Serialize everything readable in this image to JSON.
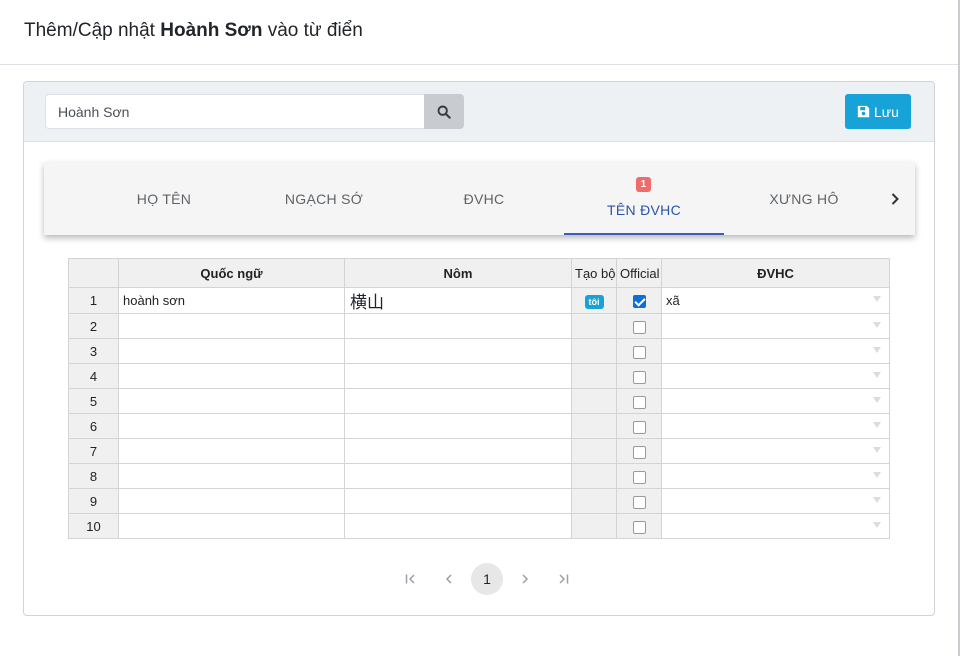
{
  "modal": {
    "title_prefix": "Thêm/Cập nhật ",
    "title_name": "Hoành Sơn",
    "title_suffix": " vào từ điển"
  },
  "toolbar": {
    "search_value": "Hoành Sơn",
    "search_icon": "search-icon",
    "save_label": "Lưu",
    "save_icon": "floppy-disk-icon",
    "save_color": "#17a2d8"
  },
  "tabs": [
    {
      "label": "HỌ TÊN",
      "active": false
    },
    {
      "label": "NGẠCH SỚ",
      "active": false
    },
    {
      "label": "ĐVHC",
      "active": false
    },
    {
      "label": "TÊN ĐVHC",
      "active": true,
      "badge": "1"
    },
    {
      "label": "XƯNG HÔ",
      "active": false
    }
  ],
  "tabs_accent": "#3f5bc0",
  "table": {
    "headers": [
      "",
      "Quốc ngữ",
      "Nôm",
      "Tạo bộ",
      "Official",
      "ĐVHC"
    ],
    "rows": [
      {
        "num": "1",
        "quoc_ngu": "hoành sơn",
        "nom": "横山",
        "tag": "tôi",
        "official": true,
        "dvhc": "xã"
      },
      {
        "num": "2",
        "quoc_ngu": "",
        "nom": "",
        "tag": "",
        "official": false,
        "dvhc": ""
      },
      {
        "num": "3",
        "quoc_ngu": "",
        "nom": "",
        "tag": "",
        "official": false,
        "dvhc": ""
      },
      {
        "num": "4",
        "quoc_ngu": "",
        "nom": "",
        "tag": "",
        "official": false,
        "dvhc": ""
      },
      {
        "num": "5",
        "quoc_ngu": "",
        "nom": "",
        "tag": "",
        "official": false,
        "dvhc": ""
      },
      {
        "num": "6",
        "quoc_ngu": "",
        "nom": "",
        "tag": "",
        "official": false,
        "dvhc": ""
      },
      {
        "num": "7",
        "quoc_ngu": "",
        "nom": "",
        "tag": "",
        "official": false,
        "dvhc": ""
      },
      {
        "num": "8",
        "quoc_ngu": "",
        "nom": "",
        "tag": "",
        "official": false,
        "dvhc": ""
      },
      {
        "num": "9",
        "quoc_ngu": "",
        "nom": "",
        "tag": "",
        "official": false,
        "dvhc": ""
      },
      {
        "num": "10",
        "quoc_ngu": "",
        "nom": "",
        "tag": "",
        "official": false,
        "dvhc": ""
      }
    ]
  },
  "pagination": {
    "current_page": "1"
  }
}
